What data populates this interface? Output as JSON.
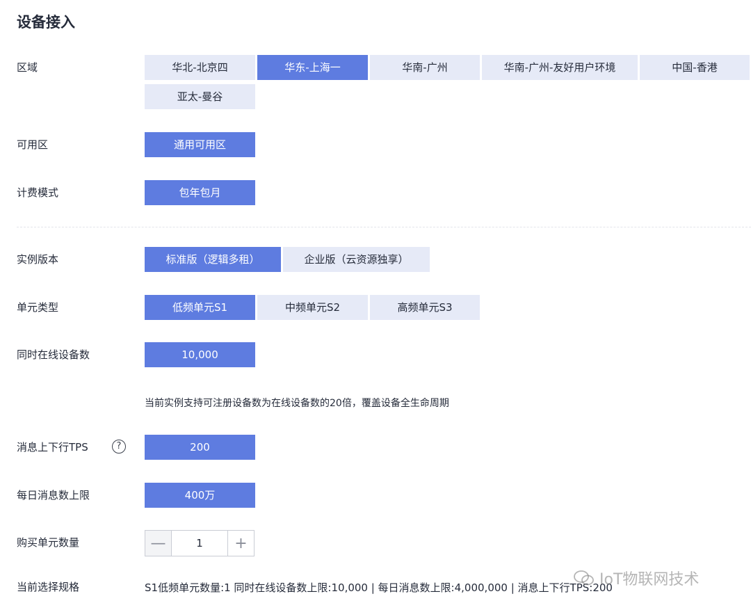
{
  "page_title": "设备接入",
  "region": {
    "label": "区域",
    "options": [
      "华北-北京四",
      "华东-上海一",
      "华南-广州",
      "华南-广州-友好用户环境",
      "中国-香港",
      "亚太-曼谷"
    ],
    "selected": "华东-上海一"
  },
  "zone": {
    "label": "可用区",
    "options": [
      "通用可用区"
    ],
    "selected": "通用可用区"
  },
  "billing": {
    "label": "计费模式",
    "options": [
      "包年包月"
    ],
    "selected": "包年包月"
  },
  "edition": {
    "label": "实例版本",
    "options": [
      "标准版（逻辑多租）",
      "企业版（云资源独享）"
    ],
    "selected": "标准版（逻辑多租）"
  },
  "unit_type": {
    "label": "单元类型",
    "options": [
      "低频单元S1",
      "中频单元S2",
      "高频单元S3"
    ],
    "selected": "低频单元S1"
  },
  "online_devices": {
    "label": "同时在线设备数",
    "value": "10,000",
    "note": "当前实例支持可注册设备数为在线设备数的20倍，覆盖设备全生命周期"
  },
  "tps": {
    "label": "消息上下行TPS",
    "help_symbol": "?",
    "value": "200"
  },
  "daily_messages": {
    "label": "每日消息数上限",
    "value": "400万"
  },
  "quantity": {
    "label": "购买单元数量",
    "value": "1",
    "minus": "—",
    "plus": "+"
  },
  "spec": {
    "label": "当前选择规格",
    "summary": "S1低频单元数量:1 同时在线设备数上限:10,000 | 每日消息数上限:4,000,000 | 消息上下行TPS:200"
  },
  "watermark": "IoT物联网技术",
  "colors": {
    "selected": "#5e7ce0",
    "unselected": "#e6eaf7",
    "text": "#252b3a"
  }
}
